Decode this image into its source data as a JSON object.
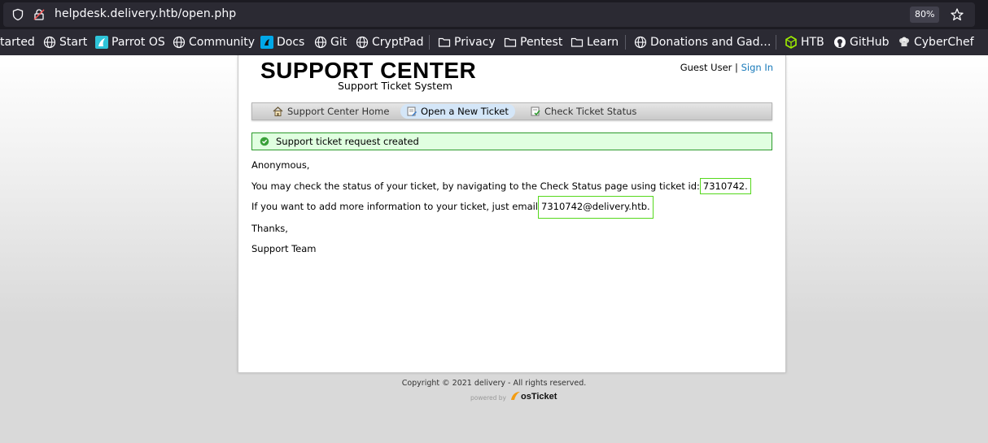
{
  "browser": {
    "url": "helpdesk.delivery.htb/open.php",
    "zoom": "80%",
    "bookmarks": [
      {
        "label": "tarted",
        "icon": "none"
      },
      {
        "label": "Start",
        "icon": "globe-icon"
      },
      {
        "label": "Parrot OS",
        "icon": "parrot-icon"
      },
      {
        "label": "Community",
        "icon": "globe-icon"
      },
      {
        "label": "Docs",
        "icon": "docs-icon"
      },
      {
        "label": "Git",
        "icon": "globe-icon"
      },
      {
        "label": "CryptPad",
        "icon": "globe-icon"
      },
      {
        "label": "Privacy",
        "icon": "folder-icon"
      },
      {
        "label": "Pentest",
        "icon": "folder-icon"
      },
      {
        "label": "Learn",
        "icon": "folder-icon"
      },
      {
        "label": "Donations and Gad…",
        "icon": "globe-icon"
      },
      {
        "label": "HTB",
        "icon": "htb-icon"
      },
      {
        "label": "GitHub",
        "icon": "github-icon"
      },
      {
        "label": "CyberChef",
        "icon": "chef-icon"
      }
    ]
  },
  "header": {
    "logo_title": "SUPPORT CENTER",
    "logo_subtitle": "Support Ticket System",
    "user": "Guest User",
    "separator": "|",
    "sign_in": "Sign In"
  },
  "nav": {
    "home": "Support Center Home",
    "open": "Open a New Ticket",
    "status": "Check Ticket Status"
  },
  "notice": "Support ticket request created",
  "message": {
    "greeting": "Anonymous,",
    "line1_prefix": "You may check the status of your ticket, by navigating to the Check Status page using ticket id:",
    "ticket_id": "7310742.",
    "line2_prefix": "If you want to add more information to your ticket, just email",
    "email": "7310742@delivery.htb.",
    "thanks": "Thanks,",
    "signature": "Support Team"
  },
  "footer": {
    "copyright": "Copyright © 2021 delivery - All rights reserved.",
    "powered_by": "powered by",
    "brand": "osTicket"
  },
  "colors": {
    "highlight": "#55d81c",
    "link": "#1779ba",
    "notice_bg": "#e0ffe0"
  }
}
